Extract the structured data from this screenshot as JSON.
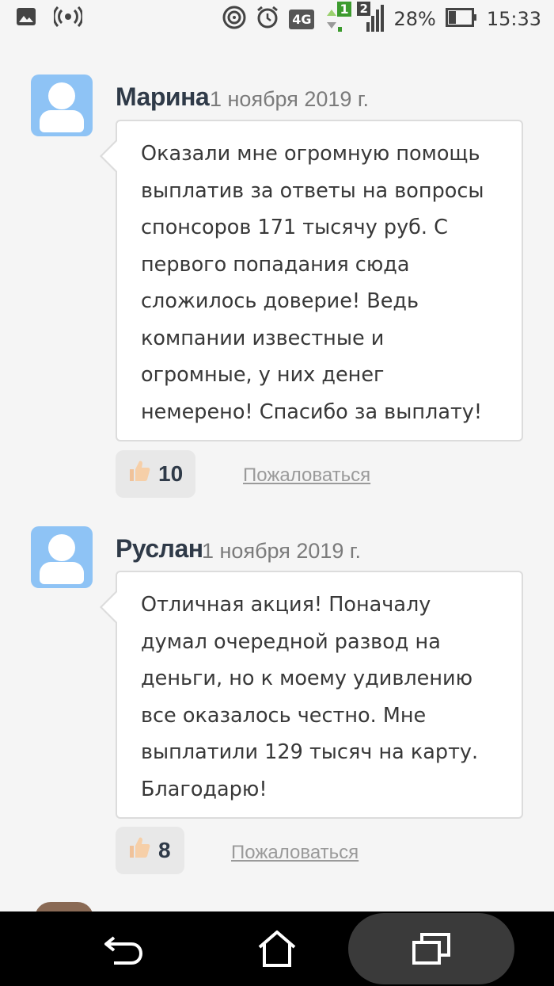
{
  "status_bar": {
    "network_type": "4G",
    "sim1_label": "1",
    "sim2_label": "2",
    "battery": "28%",
    "time": "15:33"
  },
  "comments": [
    {
      "author": "Марина",
      "date": "1 ноября 2019 г.",
      "lines": [
        "Оказали мне огромную помощь",
        "выплатив за ответы на вопросы",
        "спонсоров 171 тысячу руб. С",
        "первого попадания сюда",
        "сложилось доверие! Ведь",
        "компании известные и",
        "огромные, у них денег",
        "немерено! Спасибо за выплату!"
      ],
      "likes": "10",
      "report_label": "Пожаловаться"
    },
    {
      "author": "Руслан",
      "date": "1 ноября 2019 г.",
      "lines": [
        "Отличная акция! Поначалу",
        "думал очередной развод на",
        "деньги, но к моему удивлению",
        "все оказалось честно. Мне",
        "выплатили 129 тысяч на карту.",
        "Благодарю!"
      ],
      "likes": "8",
      "report_label": "Пожаловаться"
    }
  ],
  "nav": {
    "back": "back-icon",
    "home": "home-icon",
    "recents": "recents-icon"
  },
  "colors": {
    "avatar": "#8ec3f5",
    "name": "#2f3a48",
    "background": "#f5f5f5"
  }
}
